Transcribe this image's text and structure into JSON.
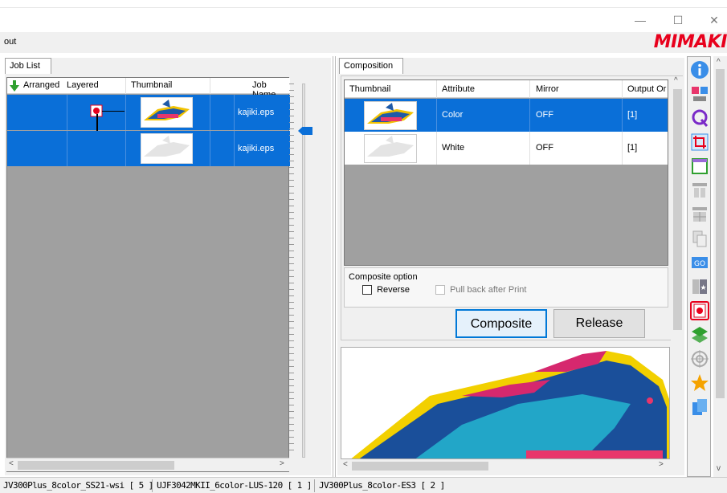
{
  "window": {
    "menu_label": "out",
    "minimize": "—",
    "maximize": "☐",
    "close": "✕",
    "logo": "MIMAKI"
  },
  "job_list": {
    "tab": "Job List",
    "columns": [
      "Arranged",
      "Layered",
      "Thumbnail",
      "Job Name"
    ],
    "rows": [
      {
        "job_name": "kajiki.eps"
      },
      {
        "job_name": "kajiki.eps"
      }
    ]
  },
  "composition": {
    "tab": "Composition",
    "columns": [
      "Thumbnail",
      "Attribute",
      "Mirror",
      "Output Or"
    ],
    "rows": [
      {
        "attribute": "Color",
        "mirror": "OFF",
        "output": "[1]"
      },
      {
        "attribute": "White",
        "mirror": "OFF",
        "output": "[1]"
      }
    ],
    "option_title": "Composite option",
    "reverse_label": "Reverse",
    "pullback_label": "Pull back after Print",
    "composite_button": "Composite",
    "release_button": "Release"
  },
  "status_bar": {
    "items": [
      "JV300Plus_8color_SS21-wsi [ 5 ]",
      "UJF3042MKII_6color-LUS-120 [ 1 ]",
      "JV300Plus_8color-ES3 [ 2 ]"
    ]
  },
  "colors": {
    "selection": "#0a6fd8",
    "brand": "#e8001c"
  }
}
